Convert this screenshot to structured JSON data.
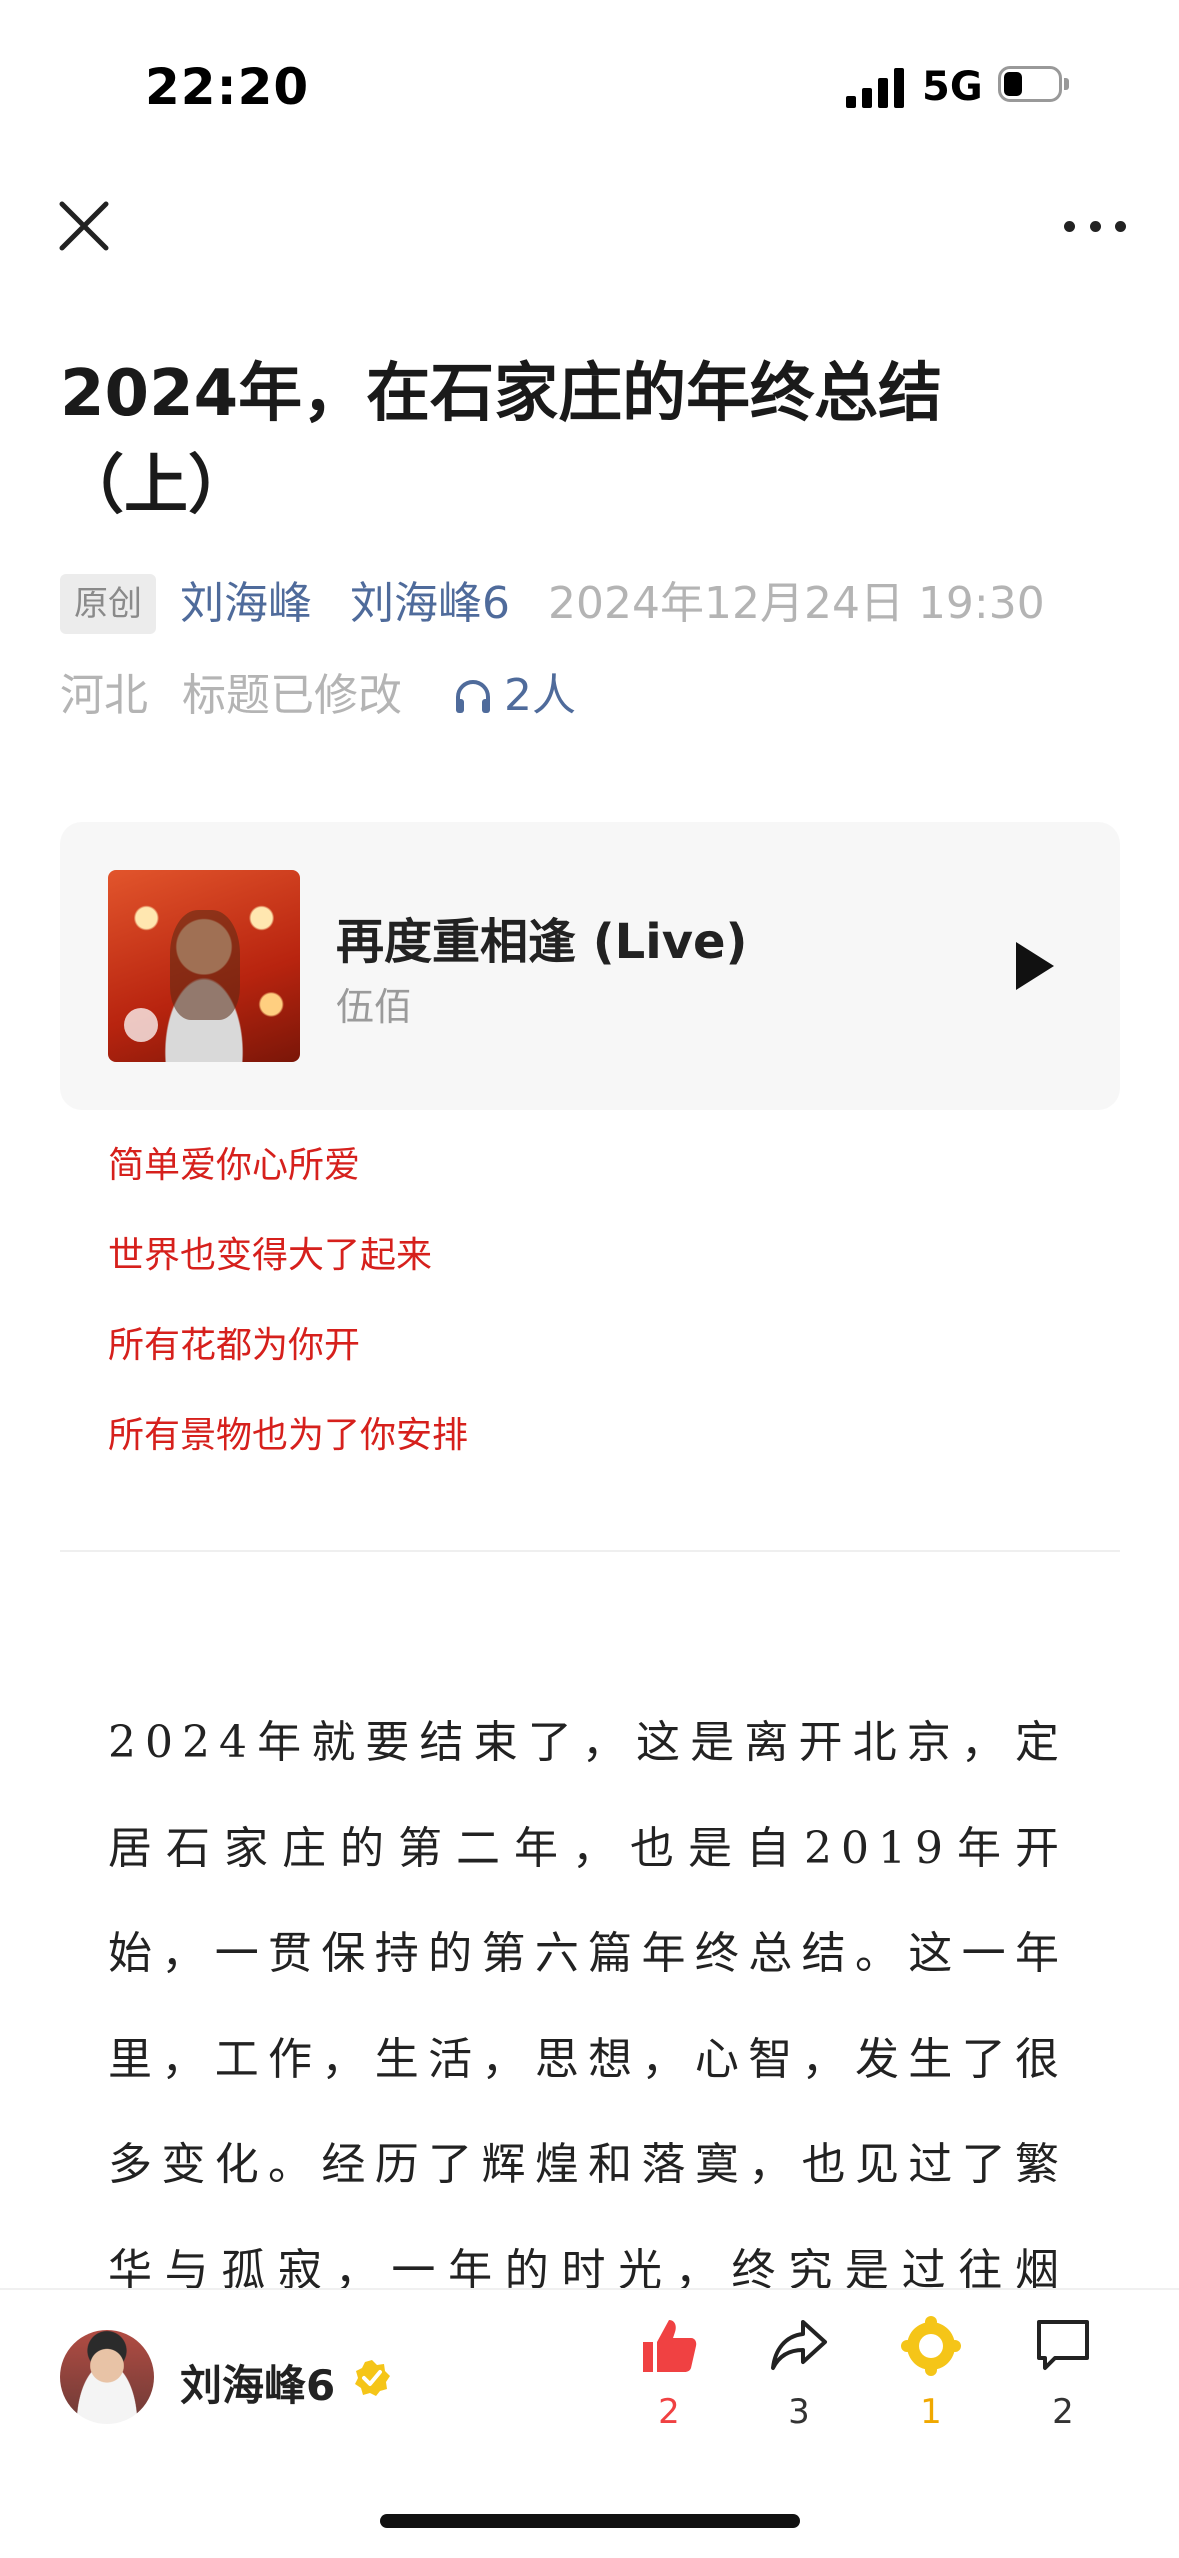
{
  "status_bar": {
    "time": "22:20",
    "network": "5G"
  },
  "article": {
    "title": "2024年，在石家庄的年终总结（上）",
    "original_badge": "原创",
    "author": "刘海峰",
    "account": "刘海峰6",
    "datetime": "2024年12月24日 19:30",
    "region": "河北",
    "edited_note": "标题已修改",
    "listeners": "2人"
  },
  "music": {
    "song_title": "再度重相逢 (Live)",
    "artist": "伍佰"
  },
  "lyrics": [
    "简单爱你心所爱",
    "世界也变得大了起来",
    "所有花都为你开",
    "所有景物也为了你安排"
  ],
  "body_text": "2024年就要结束了，这是离开北京，定居石家庄的第二年，也是自2019年开始，一贯保持的第六篇年终总结。这一年里，工作，生活，思想，心智，发生了很多变化。经历了辉煌和落寞，也见过了繁华与孤寂，一年的时光，终究是过往烟云，如",
  "bottom_bar": {
    "author_name": "刘海峰6",
    "like_count": "2",
    "share_count": "3",
    "star_count": "1",
    "comment_count": "2"
  },
  "colors": {
    "link": "#4f6b9b",
    "lyric": "#d6201c",
    "like": "#f04142",
    "star": "#f5c518"
  }
}
